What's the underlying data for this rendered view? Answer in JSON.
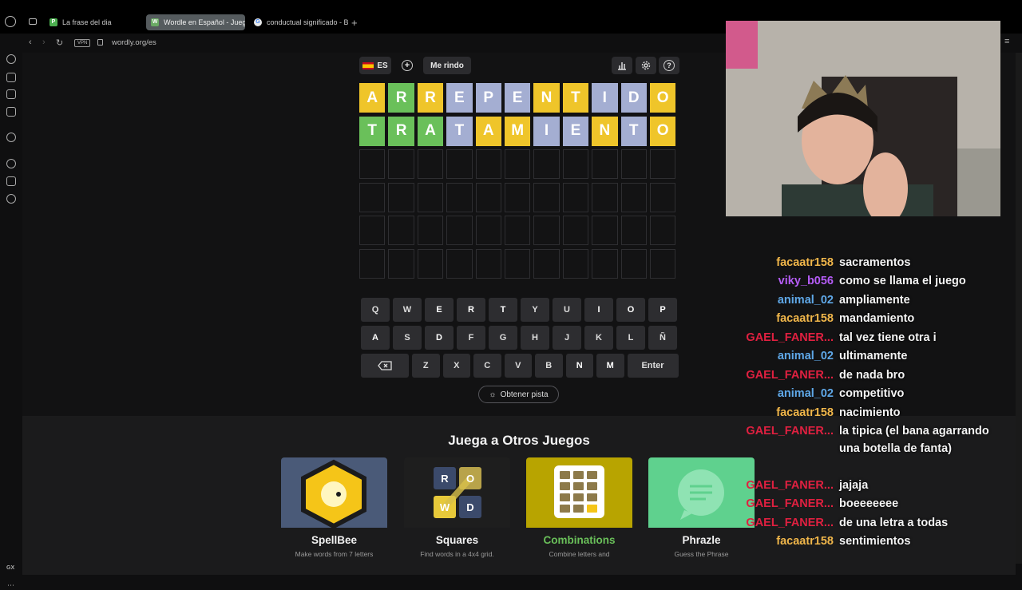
{
  "browser": {
    "tabs": [
      {
        "label": "La frase del dia",
        "favicon": "P",
        "favicon_color": "#4caf50",
        "active": false
      },
      {
        "label": "Wordle en Español - Jueg",
        "favicon": "W",
        "favicon_color": "#6aaa64",
        "active": true
      },
      {
        "label": "conductual significado - B",
        "favicon": "G",
        "favicon_color": "#e8e8e8",
        "active": false
      }
    ],
    "url": "wordly.org/es",
    "vpn_label": "VPN",
    "sidebar_label": "GX"
  },
  "game": {
    "lang_label": "ES",
    "give_up_label": "Me rindo",
    "board": [
      [
        [
          "A",
          "y"
        ],
        [
          "R",
          "g"
        ],
        [
          "R",
          "y"
        ],
        [
          "E",
          "b"
        ],
        [
          "P",
          "b"
        ],
        [
          "E",
          "b"
        ],
        [
          "N",
          "y"
        ],
        [
          "T",
          "y"
        ],
        [
          "I",
          "b"
        ],
        [
          "D",
          "b"
        ],
        [
          "O",
          "y"
        ]
      ],
      [
        [
          "T",
          "g"
        ],
        [
          "R",
          "g"
        ],
        [
          "A",
          "g"
        ],
        [
          "T",
          "b"
        ],
        [
          "A",
          "y"
        ],
        [
          "M",
          "y"
        ],
        [
          "I",
          "b"
        ],
        [
          "E",
          "b"
        ],
        [
          "N",
          "y"
        ],
        [
          "T",
          "b"
        ],
        [
          "O",
          "y"
        ]
      ]
    ],
    "empty_rows": 4,
    "columns": 11,
    "keyboard": [
      [
        [
          "Q",
          ""
        ],
        [
          "W",
          ""
        ],
        [
          "E",
          "b"
        ],
        [
          "R",
          "g"
        ],
        [
          "T",
          "g"
        ],
        [
          "Y",
          ""
        ],
        [
          "U",
          ""
        ],
        [
          "I",
          "b"
        ],
        [
          "O",
          "y"
        ],
        [
          "P",
          "b"
        ]
      ],
      [
        [
          "A",
          "g"
        ],
        [
          "S",
          ""
        ],
        [
          "D",
          "b"
        ],
        [
          "F",
          ""
        ],
        [
          "G",
          ""
        ],
        [
          "H",
          ""
        ],
        [
          "J",
          ""
        ],
        [
          "K",
          ""
        ],
        [
          "L",
          ""
        ],
        [
          "Ñ",
          ""
        ]
      ],
      [
        [
          "Z",
          ""
        ],
        [
          "X",
          ""
        ],
        [
          "C",
          ""
        ],
        [
          "V",
          ""
        ],
        [
          "B",
          ""
        ],
        [
          "N",
          "y"
        ],
        [
          "M",
          "y"
        ]
      ]
    ],
    "enter_label": "Enter",
    "hint_label": "Obtener pista"
  },
  "other_games": {
    "title": "Juega a Otros Juegos",
    "cards": [
      {
        "name": "SpellBee",
        "desc": "Make words from 7 letters",
        "bg": "#4a5a78",
        "name_color": "#f2f2f2"
      },
      {
        "name": "Squares",
        "desc": "Find words in a 4x4 grid.",
        "bg": "#1e1e1e",
        "name_color": "#f2f2f2"
      },
      {
        "name": "Combinations",
        "desc": "Combine letters and",
        "bg": "#b8a400",
        "name_color": "#6ac05a"
      },
      {
        "name": "Phrazle",
        "desc": "Guess the Phrase",
        "bg": "#5fd18e",
        "name_color": "#f2f2f2"
      }
    ],
    "squares_letters": [
      "R",
      "O",
      "W",
      "D"
    ]
  },
  "chat": {
    "messages": [
      {
        "user": "facaatr158",
        "text": "sacramentos",
        "color": "#f0b64a"
      },
      {
        "user": "viky_b056",
        "text": "como se llama el juego",
        "color": "#b45cf5"
      },
      {
        "user": "animal_02",
        "text": "ampliamente",
        "color": "#5fa8e8"
      },
      {
        "user": "facaatr158",
        "text": "mandamiento",
        "color": "#f0b64a"
      },
      {
        "user": "GAEL_FANER...",
        "text": "tal vez tiene otra i",
        "color": "#e02040"
      },
      {
        "user": "animal_02",
        "text": "ultimamente",
        "color": "#5fa8e8"
      },
      {
        "user": "GAEL_FANER...",
        "text": "de nada bro",
        "color": "#e02040"
      },
      {
        "user": "animal_02",
        "text": "competitivo",
        "color": "#5fa8e8"
      },
      {
        "user": "facaatr158",
        "text": "nacimiento",
        "color": "#f0b64a"
      },
      {
        "user": "GAEL_FANER...",
        "text": "la tipica (el bana agarrando una botella de fanta)",
        "color": "#e02040"
      },
      {
        "user": "GAEL_FANER...",
        "text": "jajaja",
        "color": "#e02040"
      },
      {
        "user": "GAEL_FANER...",
        "text": "boeeeeeee",
        "color": "#e02040"
      },
      {
        "user": "GAEL_FANER...",
        "text": "de una letra a todas",
        "color": "#e02040"
      },
      {
        "user": "facaatr158",
        "text": "sentimientos",
        "color": "#f0b64a"
      }
    ]
  },
  "colors": {
    "green": "#6ac05a",
    "yellow": "#efc52a",
    "blue_gray": "#a4aed2"
  }
}
